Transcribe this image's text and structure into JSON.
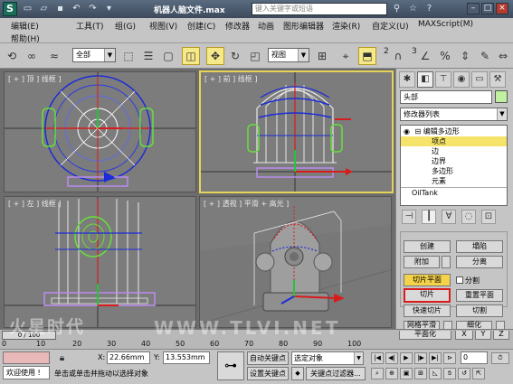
{
  "window": {
    "title": "机器人脑文件.max",
    "search_placeholder": "键入关键字或短语",
    "controls": [
      "–",
      "□",
      "×"
    ]
  },
  "menubar": {
    "row1": [
      "编辑(E)",
      "工具(T)",
      "组(G)",
      "视图(V)",
      "创建(C)",
      "修改器",
      "动画",
      "图形编辑器",
      "渲染(R)",
      "自定义(U)",
      "MAXScript(M)"
    ],
    "row2": [
      "帮助(H)"
    ]
  },
  "toolbar": {
    "selection_filter": "全部",
    "ref_coord": "视图",
    "snap_number": "2",
    "snap_number_2": "3"
  },
  "viewports": {
    "top": "[ + ] 顶 ] 线框 ]",
    "front": "[ + ] 前 ] 线框 ]",
    "left": "[ + ] 左 ] 线框 ]",
    "perspective": "[ + ] 透视 ] 平滑 + 高光 ]"
  },
  "command_panel": {
    "object_name": "头部",
    "modifier_list": "修改器列表",
    "stack": {
      "editable_poly": "编辑多边形",
      "vertex": "项点",
      "edge": "边",
      "border": "边界",
      "polygon": "多边形",
      "element": "元素",
      "base": "OilTank"
    },
    "buttons": {
      "create": "创建",
      "collapse": "塌陷",
      "attach": "附加",
      "detach": "分离",
      "slice_plane": "切片平面",
      "split": "分割",
      "slice": "切片",
      "reset_plane": "重置平面",
      "quickslice": "快速切片",
      "cut": "切割",
      "msmooth": "网格平滑",
      "tessellate": "细化",
      "make_planar": "平面化",
      "x": "X",
      "y": "Y",
      "z": "Z"
    }
  },
  "timeline": {
    "slider": "0 / 100",
    "ticks": [
      "0",
      "10",
      "20",
      "30",
      "40",
      "50",
      "60",
      "70",
      "80",
      "90",
      "100"
    ]
  },
  "statusbar": {
    "welcome": "欢迎使用 !",
    "prompt": "单击或单击并拖动以选择对象",
    "x_label": "X:",
    "x_value": "22.66mm",
    "y_label": "Y:",
    "y_value": "13.553mm",
    "auto_key": "自动关键点",
    "set_key": "设置关键点",
    "selected_object": "选定对象",
    "key_filters": "关键点过滤器...",
    "frame": "0"
  },
  "watermark": {
    "left": "火星时代",
    "right": "WWW.TLVI.NET"
  }
}
